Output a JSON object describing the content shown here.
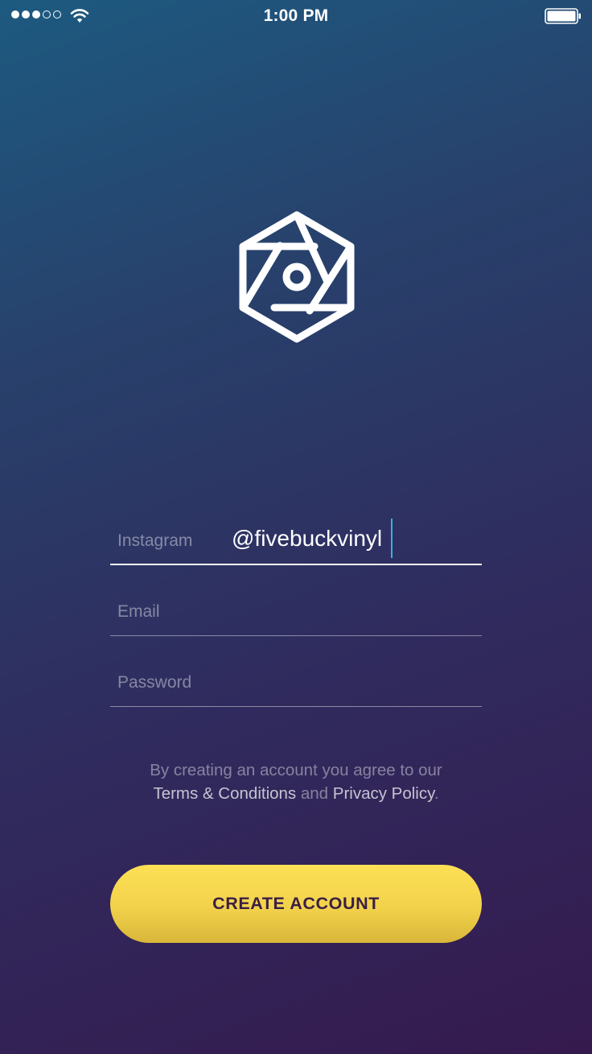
{
  "status_bar": {
    "time": "1:00 PM",
    "signal_bars_filled": 3,
    "signal_bars_total": 5,
    "wifi_icon": "wifi-icon",
    "battery_icon": "battery-full-icon"
  },
  "logo": {
    "icon": "hexagon-aperture-logo-icon"
  },
  "form": {
    "instagram": {
      "label": "Instagram",
      "value": "@fivebuckvinyl"
    },
    "email": {
      "label": "Email"
    },
    "password": {
      "label": "Password"
    }
  },
  "legal": {
    "intro": "By creating an account you agree to our",
    "terms_link": "Terms & Conditions",
    "joiner": " and ",
    "privacy_link": "Privacy Policy",
    "end": "."
  },
  "cta": {
    "label": "CREATE ACCOUNT"
  },
  "colors": {
    "gradient_top": "#1d5a80",
    "gradient_bottom": "#351a4e",
    "cta_yellow": "#f7d74e",
    "cta_text": "#3a1f45",
    "caret": "#3bb0e0"
  }
}
